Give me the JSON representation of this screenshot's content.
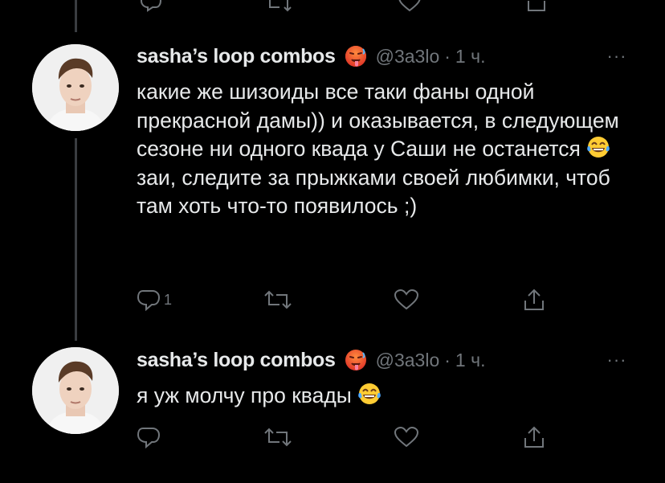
{
  "tweets": [
    {
      "author_name": "sasha’s loop combos",
      "author_emoji": "hot-face-emoji",
      "handle": "@3a3lo",
      "separator": "·",
      "time": "1 ч.",
      "more": "···",
      "text_parts": [
        "какие же шизоиды все таки фаны одной прекрасной дамы)) и оказывается, в следующем сезоне ни одного квада у Саши не останется ",
        " заи, следите за прыжками своей любимки, чтоб там хоть что-то появилось ;)"
      ],
      "inline_emoji": "face-with-tears-of-joy-emoji",
      "reply_count": "1"
    },
    {
      "author_name": "sasha’s loop combos",
      "author_emoji": "hot-face-emoji",
      "handle": "@3a3lo",
      "separator": "·",
      "time": "1 ч.",
      "more": "···",
      "text_parts": [
        "я уж молчу про квады "
      ],
      "inline_emoji": "face-with-tears-of-joy-emoji",
      "reply_count": ""
    }
  ],
  "colors": {
    "background": "#000000",
    "text": "#e7e9ea",
    "secondary": "#71767b",
    "thread_line": "#3a3d41"
  }
}
